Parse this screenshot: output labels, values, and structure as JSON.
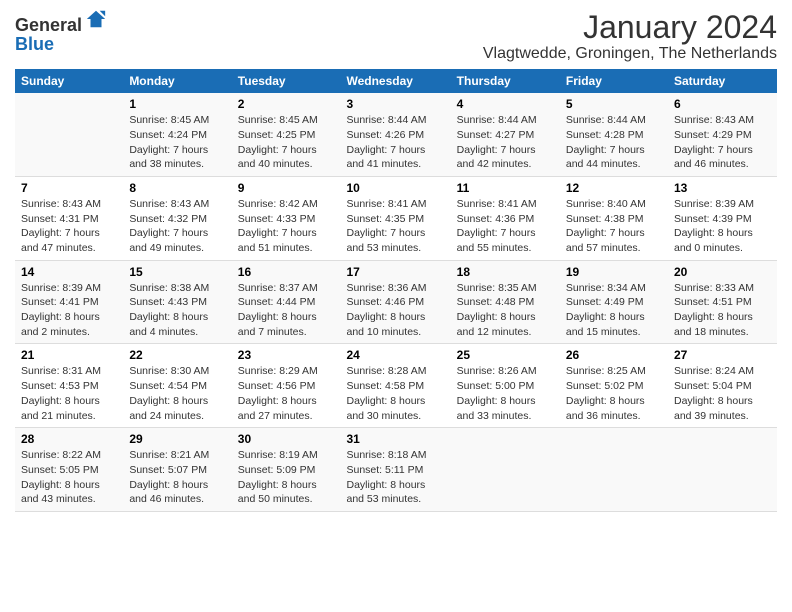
{
  "logo": {
    "text_general": "General",
    "text_blue": "Blue"
  },
  "header": {
    "month": "January 2024",
    "location": "Vlagtwedde, Groningen, The Netherlands"
  },
  "weekdays": [
    "Sunday",
    "Monday",
    "Tuesday",
    "Wednesday",
    "Thursday",
    "Friday",
    "Saturday"
  ],
  "weeks": [
    [
      {
        "day": "",
        "sunrise": "",
        "sunset": "",
        "daylight": ""
      },
      {
        "day": "1",
        "sunrise": "Sunrise: 8:45 AM",
        "sunset": "Sunset: 4:24 PM",
        "daylight": "Daylight: 7 hours and 38 minutes."
      },
      {
        "day": "2",
        "sunrise": "Sunrise: 8:45 AM",
        "sunset": "Sunset: 4:25 PM",
        "daylight": "Daylight: 7 hours and 40 minutes."
      },
      {
        "day": "3",
        "sunrise": "Sunrise: 8:44 AM",
        "sunset": "Sunset: 4:26 PM",
        "daylight": "Daylight: 7 hours and 41 minutes."
      },
      {
        "day": "4",
        "sunrise": "Sunrise: 8:44 AM",
        "sunset": "Sunset: 4:27 PM",
        "daylight": "Daylight: 7 hours and 42 minutes."
      },
      {
        "day": "5",
        "sunrise": "Sunrise: 8:44 AM",
        "sunset": "Sunset: 4:28 PM",
        "daylight": "Daylight: 7 hours and 44 minutes."
      },
      {
        "day": "6",
        "sunrise": "Sunrise: 8:43 AM",
        "sunset": "Sunset: 4:29 PM",
        "daylight": "Daylight: 7 hours and 46 minutes."
      }
    ],
    [
      {
        "day": "7",
        "sunrise": "Sunrise: 8:43 AM",
        "sunset": "Sunset: 4:31 PM",
        "daylight": "Daylight: 7 hours and 47 minutes."
      },
      {
        "day": "8",
        "sunrise": "Sunrise: 8:43 AM",
        "sunset": "Sunset: 4:32 PM",
        "daylight": "Daylight: 7 hours and 49 minutes."
      },
      {
        "day": "9",
        "sunrise": "Sunrise: 8:42 AM",
        "sunset": "Sunset: 4:33 PM",
        "daylight": "Daylight: 7 hours and 51 minutes."
      },
      {
        "day": "10",
        "sunrise": "Sunrise: 8:41 AM",
        "sunset": "Sunset: 4:35 PM",
        "daylight": "Daylight: 7 hours and 53 minutes."
      },
      {
        "day": "11",
        "sunrise": "Sunrise: 8:41 AM",
        "sunset": "Sunset: 4:36 PM",
        "daylight": "Daylight: 7 hours and 55 minutes."
      },
      {
        "day": "12",
        "sunrise": "Sunrise: 8:40 AM",
        "sunset": "Sunset: 4:38 PM",
        "daylight": "Daylight: 7 hours and 57 minutes."
      },
      {
        "day": "13",
        "sunrise": "Sunrise: 8:39 AM",
        "sunset": "Sunset: 4:39 PM",
        "daylight": "Daylight: 8 hours and 0 minutes."
      }
    ],
    [
      {
        "day": "14",
        "sunrise": "Sunrise: 8:39 AM",
        "sunset": "Sunset: 4:41 PM",
        "daylight": "Daylight: 8 hours and 2 minutes."
      },
      {
        "day": "15",
        "sunrise": "Sunrise: 8:38 AM",
        "sunset": "Sunset: 4:43 PM",
        "daylight": "Daylight: 8 hours and 4 minutes."
      },
      {
        "day": "16",
        "sunrise": "Sunrise: 8:37 AM",
        "sunset": "Sunset: 4:44 PM",
        "daylight": "Daylight: 8 hours and 7 minutes."
      },
      {
        "day": "17",
        "sunrise": "Sunrise: 8:36 AM",
        "sunset": "Sunset: 4:46 PM",
        "daylight": "Daylight: 8 hours and 10 minutes."
      },
      {
        "day": "18",
        "sunrise": "Sunrise: 8:35 AM",
        "sunset": "Sunset: 4:48 PM",
        "daylight": "Daylight: 8 hours and 12 minutes."
      },
      {
        "day": "19",
        "sunrise": "Sunrise: 8:34 AM",
        "sunset": "Sunset: 4:49 PM",
        "daylight": "Daylight: 8 hours and 15 minutes."
      },
      {
        "day": "20",
        "sunrise": "Sunrise: 8:33 AM",
        "sunset": "Sunset: 4:51 PM",
        "daylight": "Daylight: 8 hours and 18 minutes."
      }
    ],
    [
      {
        "day": "21",
        "sunrise": "Sunrise: 8:31 AM",
        "sunset": "Sunset: 4:53 PM",
        "daylight": "Daylight: 8 hours and 21 minutes."
      },
      {
        "day": "22",
        "sunrise": "Sunrise: 8:30 AM",
        "sunset": "Sunset: 4:54 PM",
        "daylight": "Daylight: 8 hours and 24 minutes."
      },
      {
        "day": "23",
        "sunrise": "Sunrise: 8:29 AM",
        "sunset": "Sunset: 4:56 PM",
        "daylight": "Daylight: 8 hours and 27 minutes."
      },
      {
        "day": "24",
        "sunrise": "Sunrise: 8:28 AM",
        "sunset": "Sunset: 4:58 PM",
        "daylight": "Daylight: 8 hours and 30 minutes."
      },
      {
        "day": "25",
        "sunrise": "Sunrise: 8:26 AM",
        "sunset": "Sunset: 5:00 PM",
        "daylight": "Daylight: 8 hours and 33 minutes."
      },
      {
        "day": "26",
        "sunrise": "Sunrise: 8:25 AM",
        "sunset": "Sunset: 5:02 PM",
        "daylight": "Daylight: 8 hours and 36 minutes."
      },
      {
        "day": "27",
        "sunrise": "Sunrise: 8:24 AM",
        "sunset": "Sunset: 5:04 PM",
        "daylight": "Daylight: 8 hours and 39 minutes."
      }
    ],
    [
      {
        "day": "28",
        "sunrise": "Sunrise: 8:22 AM",
        "sunset": "Sunset: 5:05 PM",
        "daylight": "Daylight: 8 hours and 43 minutes."
      },
      {
        "day": "29",
        "sunrise": "Sunrise: 8:21 AM",
        "sunset": "Sunset: 5:07 PM",
        "daylight": "Daylight: 8 hours and 46 minutes."
      },
      {
        "day": "30",
        "sunrise": "Sunrise: 8:19 AM",
        "sunset": "Sunset: 5:09 PM",
        "daylight": "Daylight: 8 hours and 50 minutes."
      },
      {
        "day": "31",
        "sunrise": "Sunrise: 8:18 AM",
        "sunset": "Sunset: 5:11 PM",
        "daylight": "Daylight: 8 hours and 53 minutes."
      },
      {
        "day": "",
        "sunrise": "",
        "sunset": "",
        "daylight": ""
      },
      {
        "day": "",
        "sunrise": "",
        "sunset": "",
        "daylight": ""
      },
      {
        "day": "",
        "sunrise": "",
        "sunset": "",
        "daylight": ""
      }
    ]
  ]
}
